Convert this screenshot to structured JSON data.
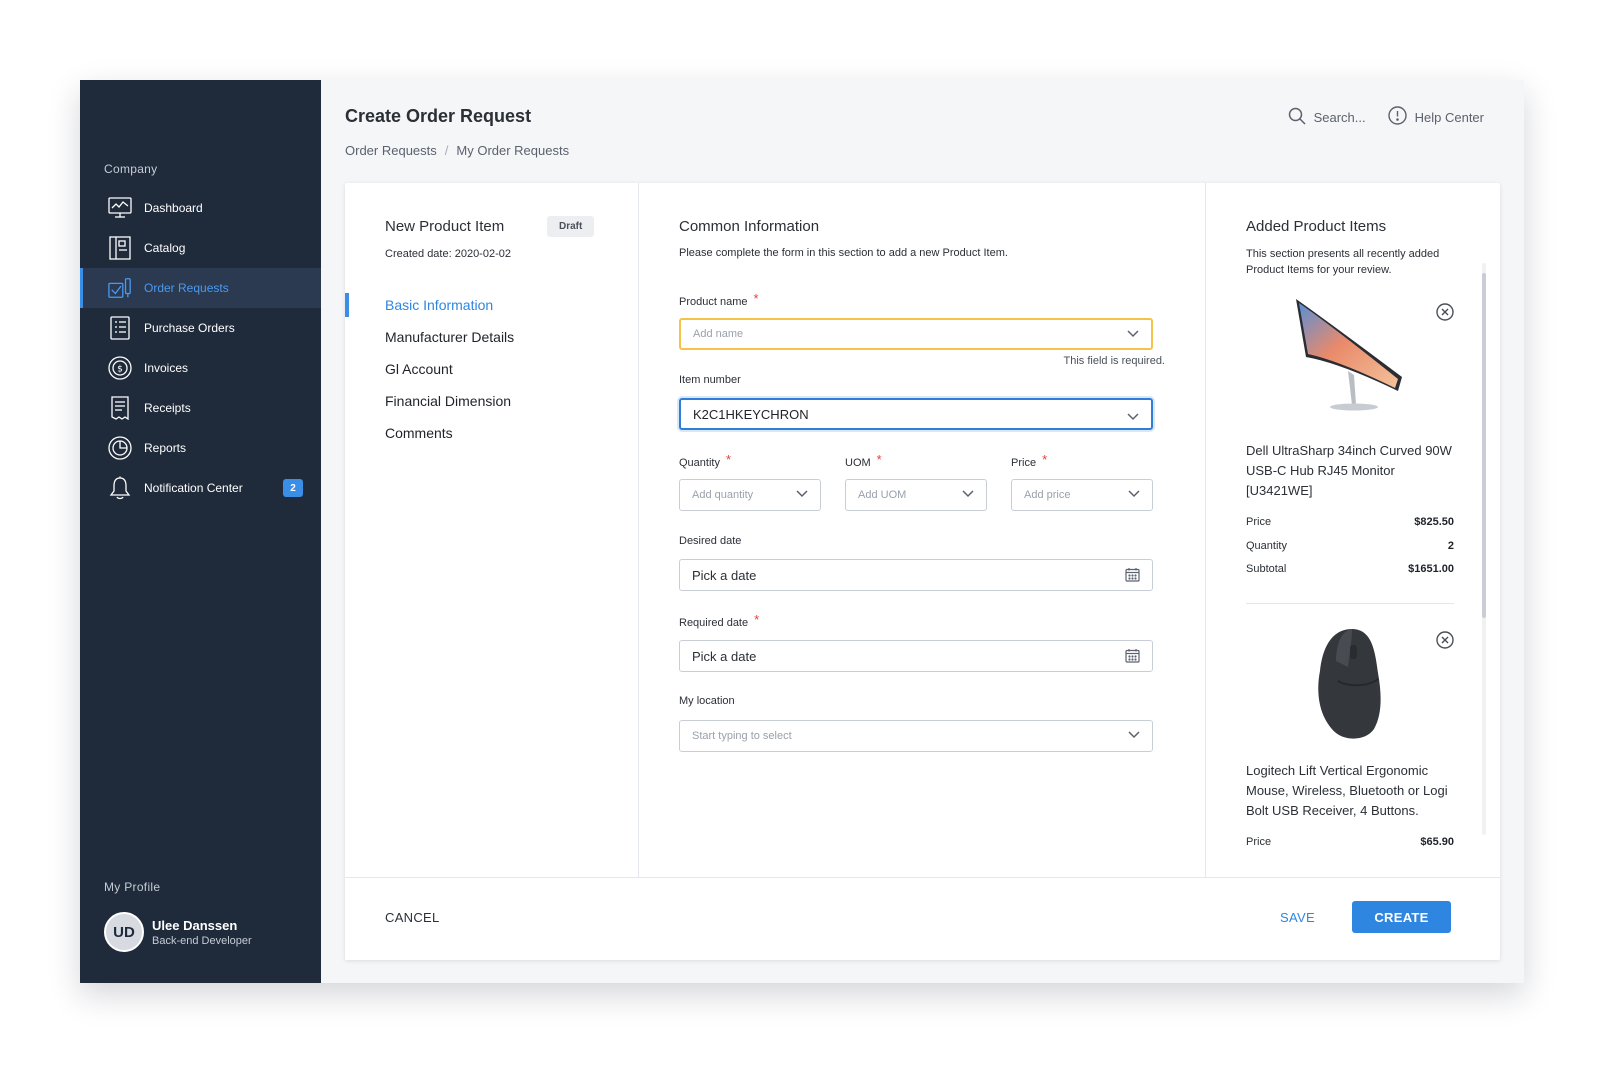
{
  "sidebar": {
    "section_label": "Company",
    "items": [
      {
        "label": "Dashboard",
        "icon": "dashboard-icon"
      },
      {
        "label": "Catalog",
        "icon": "catalog-icon"
      },
      {
        "label": "Order Requests",
        "icon": "order-requests-icon",
        "active": true
      },
      {
        "label": "Purchase Orders",
        "icon": "purchase-orders-icon"
      },
      {
        "label": "Invoices",
        "icon": "invoices-icon"
      },
      {
        "label": "Receipts",
        "icon": "receipts-icon"
      },
      {
        "label": "Reports",
        "icon": "reports-icon"
      },
      {
        "label": "Notification Center",
        "icon": "bell-icon",
        "badge": "2"
      }
    ],
    "profile_label": "My Profile",
    "profile": {
      "initials": "UD",
      "name": "Ulee Danssen",
      "role": "Back-end Developer"
    }
  },
  "header": {
    "title": "Create Order Request",
    "breadcrumb": [
      "Order Requests",
      "My Order Requests"
    ],
    "breadcrumb_sep": "/",
    "search_label": "Search...",
    "help_label": "Help Center"
  },
  "left": {
    "title": "New Product Item",
    "status": "Draft",
    "created": "Created date: 2020-02-02",
    "sections": [
      "Basic Information",
      "Manufacturer Details",
      "Gl Account",
      "Financial Dimension",
      "Comments"
    ]
  },
  "form": {
    "title": "Common Information",
    "subtitle": "Please complete the form in this section to add a new Product Item.",
    "product_name": {
      "label": "Product name",
      "placeholder": "Add name",
      "error": "This field is required."
    },
    "item_number": {
      "label": "Item number",
      "value": "K2C1HKEYCHRON"
    },
    "quantity": {
      "label": "Quantity",
      "placeholder": "Add quantity"
    },
    "uom": {
      "label": "UOM",
      "placeholder": "Add UOM"
    },
    "price": {
      "label": "Price",
      "placeholder": "Add price"
    },
    "desired_date": {
      "label": "Desired date",
      "value": "Pick a date"
    },
    "required_date": {
      "label": "Required date",
      "value": "Pick a date"
    },
    "location": {
      "label": "My location",
      "placeholder": "Start typing to select"
    },
    "required_mark": "*"
  },
  "added": {
    "title": "Added Product Items",
    "subtitle": "This section presents all recently added Product Items for your review.",
    "items": [
      {
        "name": "Dell UltraSharp 34inch Curved 90W USB-C Hub RJ45 Monitor [U3421WE]",
        "rows": [
          {
            "k": "Price",
            "v": "$825.50"
          },
          {
            "k": "Quantity",
            "v": "2"
          },
          {
            "k": "Subtotal",
            "v": "$1651.00"
          }
        ]
      },
      {
        "name": "Logitech Lift Vertical Ergonomic Mouse, Wireless, Bluetooth or Logi Bolt USB Receiver, 4 Buttons.",
        "rows": [
          {
            "k": "Price",
            "v": "$65.90"
          }
        ]
      }
    ]
  },
  "footer": {
    "cancel": "CANCEL",
    "save": "SAVE",
    "create": "CREATE"
  },
  "colors": {
    "accent": "#2f86e0",
    "sidebar_bg": "#1f2a3a",
    "warning": "#f5c34a",
    "required": "#e5413b"
  }
}
